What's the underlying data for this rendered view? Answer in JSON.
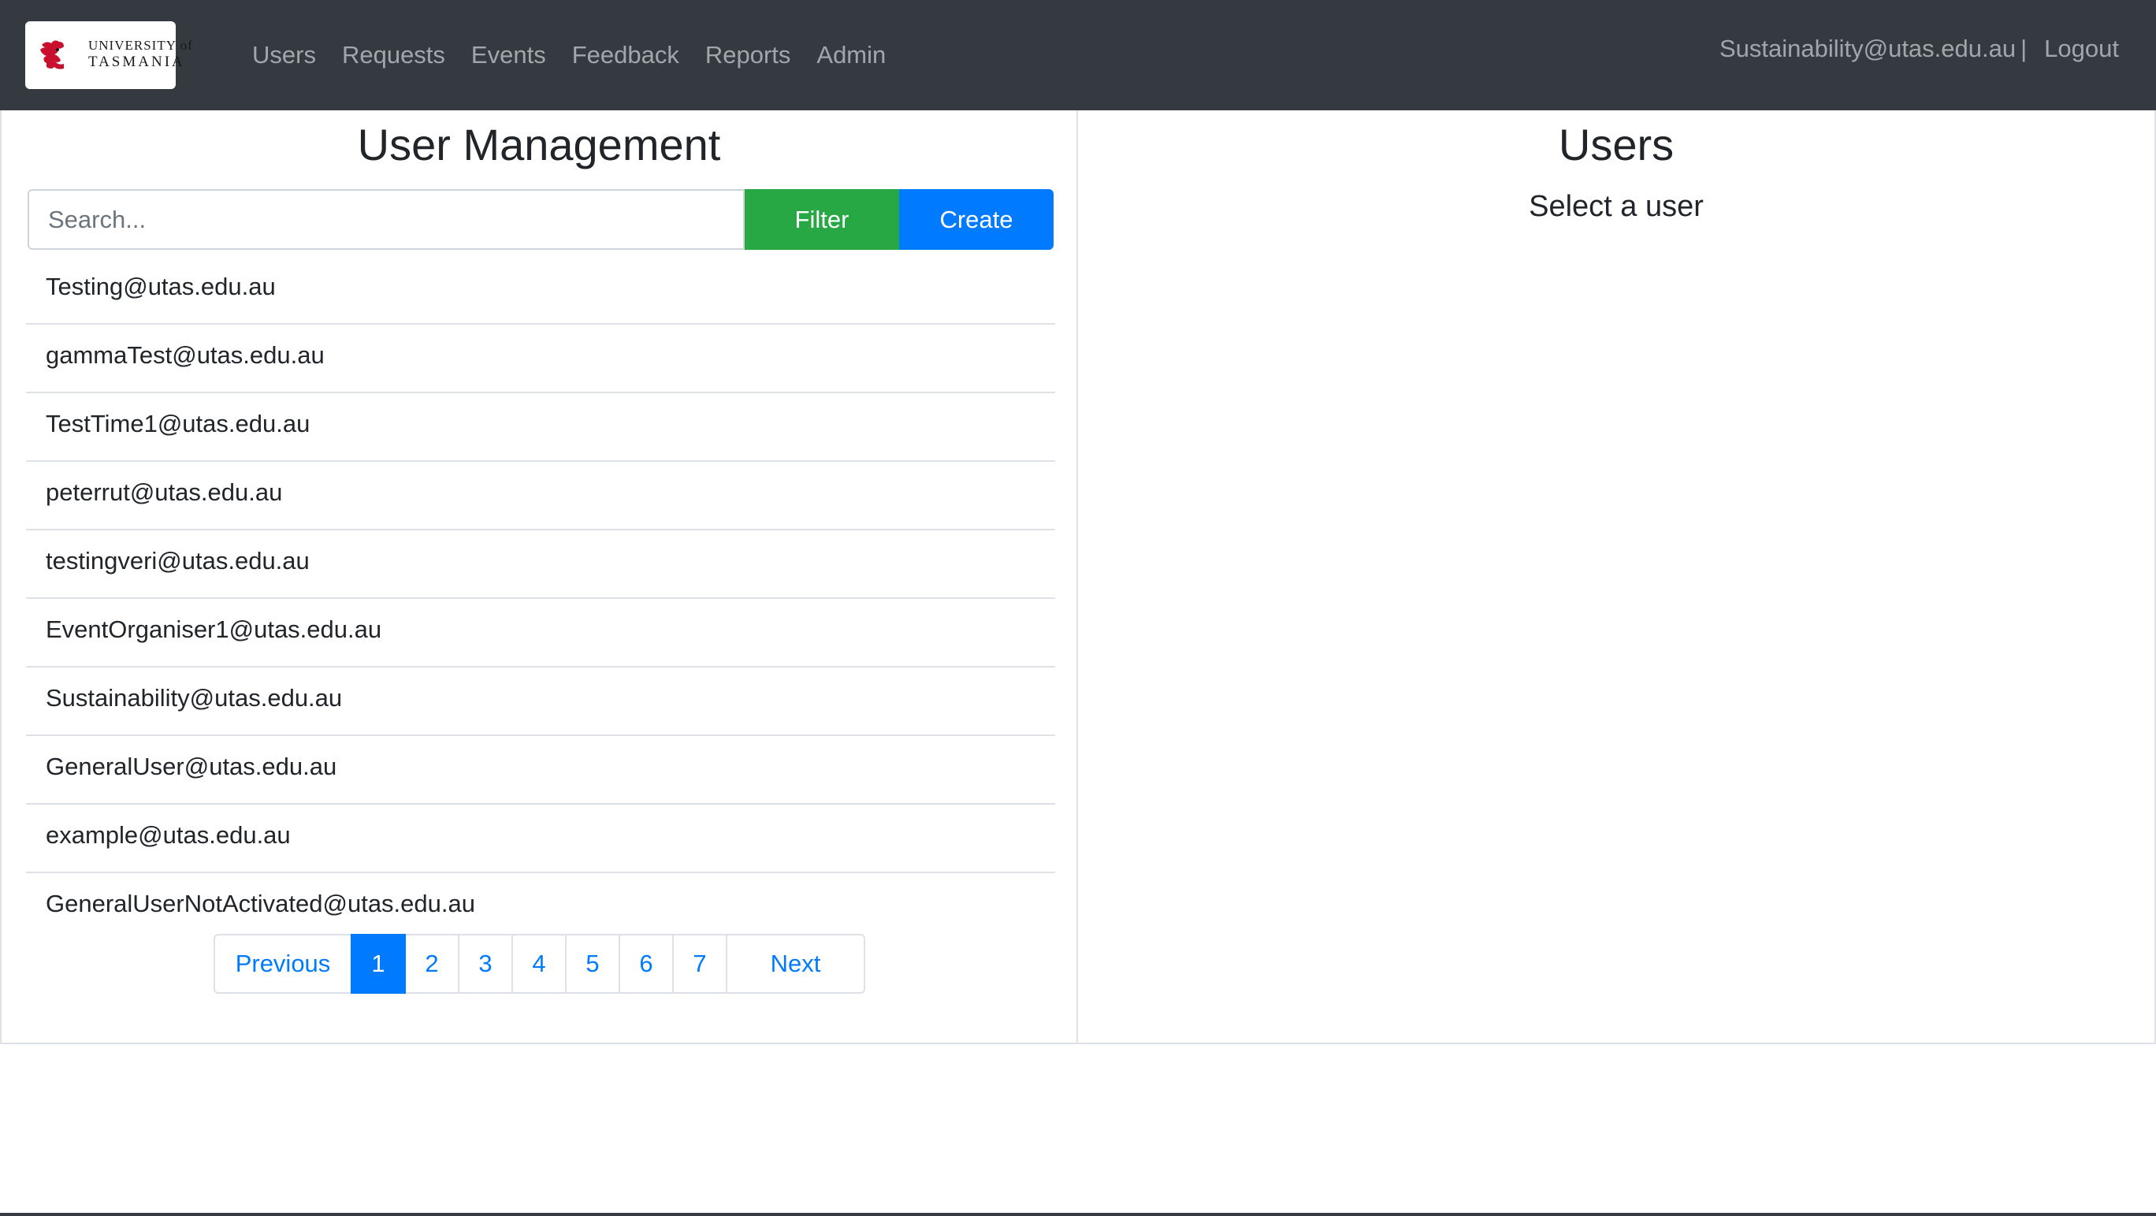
{
  "navbar": {
    "logo": {
      "line1": "UNIVERSITY of",
      "line2": "TASMANIA",
      "accent_color": "#c8102e"
    },
    "links": [
      "Users",
      "Requests",
      "Events",
      "Feedback",
      "Reports",
      "Admin"
    ],
    "current_user": "Sustainability@utas.edu.au",
    "separator": "|",
    "logout_label": "Logout"
  },
  "left_panel": {
    "title": "User Management",
    "search": {
      "placeholder": "Search...",
      "value": ""
    },
    "filter_label": "Filter",
    "create_label": "Create",
    "users": [
      "Testing@utas.edu.au",
      "gammaTest@utas.edu.au",
      "TestTime1@utas.edu.au",
      "peterrut@utas.edu.au",
      "testingveri@utas.edu.au",
      "EventOrganiser1@utas.edu.au",
      "Sustainability@utas.edu.au",
      "GeneralUser@utas.edu.au",
      "example@utas.edu.au",
      "GeneralUserNotActivated@utas.edu.au"
    ],
    "pagination": {
      "previous_label": "Previous",
      "next_label": "Next",
      "pages": [
        "1",
        "2",
        "3",
        "4",
        "5",
        "6",
        "7"
      ],
      "current_page": "1"
    }
  },
  "right_panel": {
    "title": "Users",
    "placeholder_text": "Select a user"
  },
  "colors": {
    "navbar_bg": "#343a40",
    "filter_button": "#28a745",
    "primary": "#007bff",
    "border": "#dee2e6"
  }
}
